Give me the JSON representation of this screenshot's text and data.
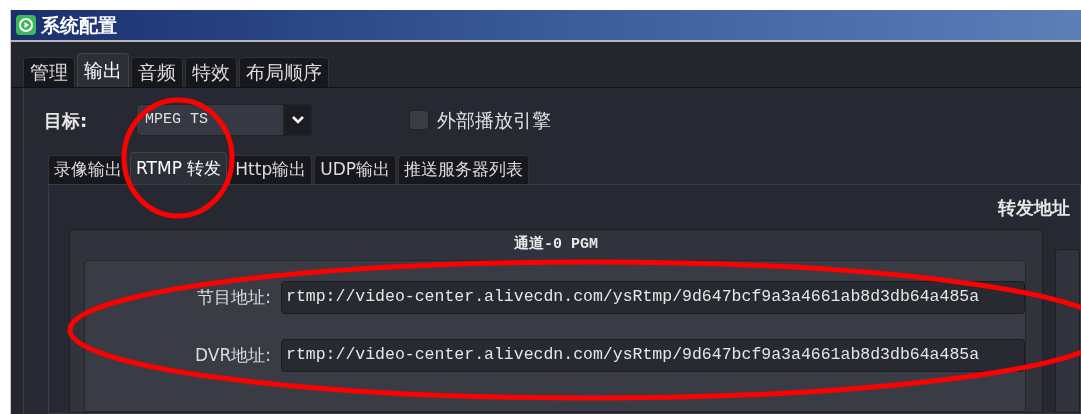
{
  "window": {
    "title": "系统配置"
  },
  "tabs": [
    {
      "label": "管理",
      "selected": false
    },
    {
      "label": "输出",
      "selected": true
    },
    {
      "label": "音频",
      "selected": false
    },
    {
      "label": "特效",
      "selected": false
    },
    {
      "label": "布局顺序",
      "selected": false
    }
  ],
  "target": {
    "label": "目标:",
    "value": "MPEG TS"
  },
  "external_engine": {
    "label": "外部播放引擎",
    "checked": false
  },
  "sub_tabs": [
    {
      "label": "录像输出",
      "selected": false
    },
    {
      "label": "RTMP 转发",
      "selected": true
    },
    {
      "label": "Http输出",
      "selected": false
    },
    {
      "label": "UDP输出",
      "selected": false
    },
    {
      "label": "推送服务器列表",
      "selected": false
    }
  ],
  "section_title": "转发地址",
  "channel": {
    "title": "通道-0 PGM",
    "fields": [
      {
        "label": "节目地址:",
        "value": "rtmp://video-center.alivecdn.com/ysRtmp/9d647bcf9a3a4661ab8d3db64a485a"
      },
      {
        "label": "DVR地址:",
        "value": "rtmp://video-center.alivecdn.com/ysRtmp/9d647bcf9a3a4661ab8d3db64a485a"
      }
    ]
  }
}
